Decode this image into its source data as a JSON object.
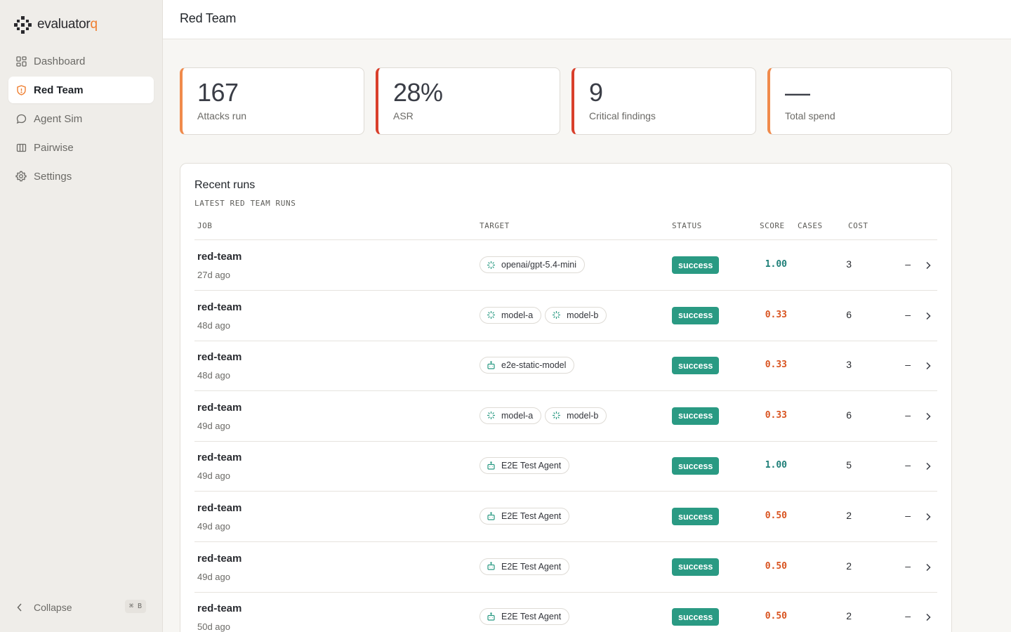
{
  "brand": {
    "name_main": "evaluator",
    "name_accent": "q",
    "accent_color": "#ef7e2f"
  },
  "sidebar": {
    "items": [
      {
        "label": "Dashboard",
        "icon": "dashboard-icon",
        "active": false
      },
      {
        "label": "Red Team",
        "icon": "shield-icon",
        "active": true
      },
      {
        "label": "Agent Sim",
        "icon": "chat-bubble-icon",
        "active": false
      },
      {
        "label": "Pairwise",
        "icon": "columns-icon",
        "active": false
      },
      {
        "label": "Settings",
        "icon": "gear-icon",
        "active": false
      }
    ],
    "collapse_label": "Collapse",
    "collapse_shortcut": "⌘ B"
  },
  "header": {
    "title": "Red Team"
  },
  "stats": [
    {
      "value": "167",
      "label": "Attacks run",
      "accent": "#f08a4b"
    },
    {
      "value": "28%",
      "label": "ASR",
      "accent": "#d93f2b"
    },
    {
      "value": "9",
      "label": "Critical findings",
      "accent": "#d93f2b"
    },
    {
      "value": "—",
      "label": "Total spend",
      "accent": "#f08a4b"
    }
  ],
  "runs": {
    "title": "Recent runs",
    "subtitle": "LATEST RED TEAM RUNS",
    "columns": {
      "job": "JOB",
      "target": "TARGET",
      "status": "STATUS",
      "score": "SCORE",
      "cases": "CASES",
      "cost": "COST"
    },
    "rows": [
      {
        "job": "red-team",
        "ago": "27d ago",
        "targets": [
          {
            "name": "openai/gpt-5.4-mini",
            "icon": "sparkle-icon"
          }
        ],
        "status": "success",
        "score": "1.00",
        "score_good": true,
        "cases": "3",
        "cost": "–"
      },
      {
        "job": "red-team",
        "ago": "48d ago",
        "targets": [
          {
            "name": "model-a",
            "icon": "sparkle-icon"
          },
          {
            "name": "model-b",
            "icon": "sparkle-icon"
          }
        ],
        "status": "success",
        "score": "0.33",
        "score_good": false,
        "cases": "6",
        "cost": "–"
      },
      {
        "job": "red-team",
        "ago": "48d ago",
        "targets": [
          {
            "name": "e2e-static-model",
            "icon": "robot-icon"
          }
        ],
        "status": "success",
        "score": "0.33",
        "score_good": false,
        "cases": "3",
        "cost": "–"
      },
      {
        "job": "red-team",
        "ago": "49d ago",
        "targets": [
          {
            "name": "model-a",
            "icon": "sparkle-icon"
          },
          {
            "name": "model-b",
            "icon": "sparkle-icon"
          }
        ],
        "status": "success",
        "score": "0.33",
        "score_good": false,
        "cases": "6",
        "cost": "–"
      },
      {
        "job": "red-team",
        "ago": "49d ago",
        "targets": [
          {
            "name": "E2E Test Agent",
            "icon": "robot-icon"
          }
        ],
        "status": "success",
        "score": "1.00",
        "score_good": true,
        "cases": "5",
        "cost": "–"
      },
      {
        "job": "red-team",
        "ago": "49d ago",
        "targets": [
          {
            "name": "E2E Test Agent",
            "icon": "robot-icon"
          }
        ],
        "status": "success",
        "score": "0.50",
        "score_good": false,
        "cases": "2",
        "cost": "–"
      },
      {
        "job": "red-team",
        "ago": "49d ago",
        "targets": [
          {
            "name": "E2E Test Agent",
            "icon": "robot-icon"
          }
        ],
        "status": "success",
        "score": "0.50",
        "score_good": false,
        "cases": "2",
        "cost": "–"
      },
      {
        "job": "red-team",
        "ago": "50d ago",
        "targets": [
          {
            "name": "E2E Test Agent",
            "icon": "robot-icon"
          }
        ],
        "status": "success",
        "score": "0.50",
        "score_good": false,
        "cases": "2",
        "cost": "–"
      }
    ]
  }
}
